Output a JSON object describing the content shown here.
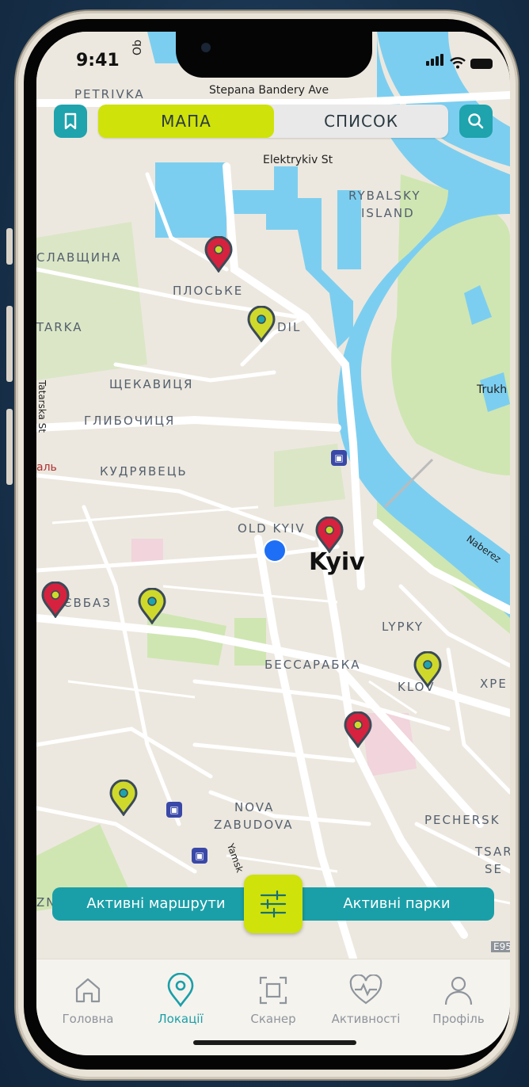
{
  "status": {
    "time": "9:41"
  },
  "header": {
    "tabs": [
      {
        "label": "МАПА",
        "active": true
      },
      {
        "label": "СПИСОК",
        "active": false
      }
    ],
    "bookmark_icon": "bookmark-icon",
    "search_icon": "search-icon"
  },
  "map": {
    "labels": {
      "petrivka": "PETRIVKA",
      "bandery": "Stepana Bandery Ave",
      "ob": "Ob",
      "elektrykiv": "Elektrykiv St",
      "rybalsky1": "RYBALSKY",
      "rybalsky2": "ISLAND",
      "slavshchyna": "СЛАВЩИНА",
      "ploske": "ПЛОСЬКЕ",
      "tarka": "TARKA",
      "podil": "DIL",
      "tatarska": "Tatarska St",
      "shchekavytsia": "ЩЕКАВИЦЯ",
      "hlybochytsia": "ГЛИБОЧИЦЯ",
      "trukh": "Trukh",
      "al": "аль",
      "kudriavets": "КУДРЯВЕЦЬ",
      "old_kyiv": "OLD KYIV",
      "kyiv": "Kyiv",
      "naberezh": "Naberez",
      "yevbaz": "ЄВБАЗ",
      "lypky": "LYPKY",
      "bessarabka": "БЕССАРАБКА",
      "klov": "KLOV",
      "khre": "ХРЕ",
      "nova1": "NOVA",
      "nova2": "ZABUDOVA",
      "pechersk": "PECHERSK",
      "tsar": "TSAR",
      "se": "SE",
      "yamska": "Yamsk",
      "zn": "ZN",
      "e95": "E95"
    },
    "colors": {
      "water": "#7ccef0",
      "park": "#cfe6b2",
      "land": "#ece8df",
      "pin_red": "#d6223f",
      "pin_yellow": "#cfd92c",
      "pin_border": "#3b4a57"
    }
  },
  "actions": {
    "left": "Активні маршрути",
    "right": "Активні парки",
    "filter_icon": "sliders-icon"
  },
  "tabbar": {
    "items": [
      {
        "label": "Головна",
        "icon": "home-icon",
        "active": false
      },
      {
        "label": "Локації",
        "icon": "location-pin-icon",
        "active": true
      },
      {
        "label": "Сканер",
        "icon": "scan-icon",
        "active": false
      },
      {
        "label": "Активності",
        "icon": "heart-pulse-icon",
        "active": false
      },
      {
        "label": "Профіль",
        "icon": "user-icon",
        "active": false
      }
    ],
    "active_color": "#1a9fa8"
  }
}
